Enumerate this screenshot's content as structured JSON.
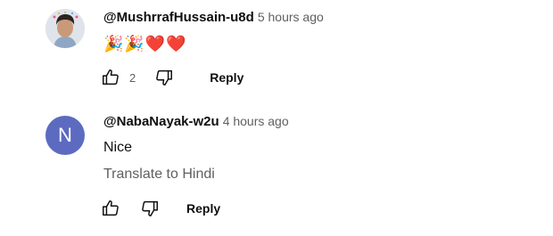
{
  "comments": [
    {
      "author": "@MushrrafHussain-u8d",
      "time": "5 hours ago",
      "text": "🎉🎉❤️❤️",
      "likes": "2",
      "reply_label": "Reply",
      "avatar_type": "photo"
    },
    {
      "author": "@NabaNayak-w2u",
      "time": "4 hours ago",
      "text": "Nice",
      "translate_label": "Translate to Hindi",
      "likes": "",
      "reply_label": "Reply",
      "avatar_letter": "N",
      "avatar_color": "#5c6bc0"
    }
  ],
  "icons": {
    "like": "thumbs-up-icon",
    "dislike": "thumbs-down-icon"
  }
}
